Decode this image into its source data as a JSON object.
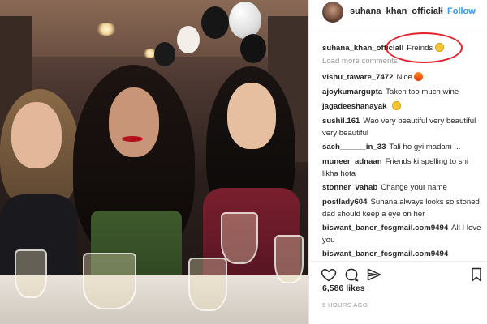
{
  "post": {
    "author": "suhana_khan_officiall",
    "follow_label": "Follow",
    "separator": "•",
    "caption_user": "suhana_khan_officiall",
    "caption_text": "Freinds",
    "load_more": "Load more comments",
    "likes": "6,586 likes",
    "timestamp": "6 HOURS AGO"
  },
  "comments": [
    {
      "user": "vishu_taware_7472",
      "text": "Nice",
      "emoji": "fire-emoji"
    },
    {
      "user": "ajoykumargupta",
      "text": "Taken too much wine",
      "emoji": ""
    },
    {
      "user": "jagadeeshanayak",
      "text": "",
      "emoji": "smile-emoji"
    },
    {
      "user": "sushil.161",
      "text": "Wao very beautiful very beautiful very beautiful",
      "emoji": ""
    },
    {
      "user": "sach______in_33",
      "text": "Tali ho gyi madam ...",
      "emoji": ""
    },
    {
      "user": "muneer_adnaan",
      "text": "Friends ki spelling to shi likha hota",
      "emoji": ""
    },
    {
      "user": "stonner_vahab",
      "text": "Change your name",
      "emoji": ""
    },
    {
      "user": "postlady604",
      "text": "Suhana always looks so stoned dad should keep a eye on her",
      "emoji": ""
    },
    {
      "user": "biswant_baner_fcsgmail.com9494",
      "text": "All I love you",
      "emoji": ""
    },
    {
      "user": "biswant_baner_fcsgmail.com9494",
      "text": "",
      "emoji": ""
    }
  ],
  "colors": {
    "link_blue": "#3897f0",
    "highlight_red": "#e4202b",
    "text": "#262626",
    "muted": "#999999"
  },
  "icons": [
    "heart-icon",
    "comment-icon",
    "share-icon",
    "bookmark-icon"
  ]
}
